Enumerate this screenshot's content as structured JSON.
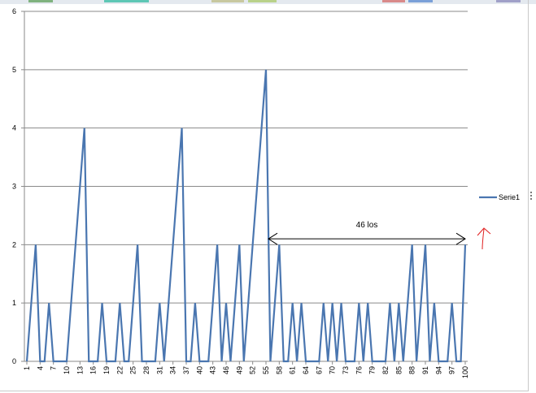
{
  "chart_data": {
    "type": "line",
    "x": [
      1,
      2,
      3,
      4,
      5,
      6,
      7,
      8,
      9,
      10,
      11,
      12,
      13,
      14,
      15,
      16,
      17,
      18,
      19,
      20,
      21,
      22,
      23,
      24,
      25,
      26,
      27,
      28,
      29,
      30,
      31,
      32,
      33,
      34,
      35,
      36,
      37,
      38,
      39,
      40,
      41,
      42,
      43,
      44,
      45,
      46,
      47,
      48,
      49,
      50,
      51,
      52,
      53,
      54,
      55,
      56,
      57,
      58,
      59,
      60,
      61,
      62,
      63,
      64,
      65,
      66,
      67,
      68,
      69,
      70,
      71,
      72,
      73,
      74,
      75,
      76,
      77,
      78,
      79,
      80,
      81,
      82,
      83,
      84,
      85,
      86,
      87,
      88,
      89,
      90,
      91,
      92,
      93,
      94,
      95,
      96,
      97,
      98,
      99,
      100
    ],
    "x_tick_labels": [
      "1",
      "4",
      "7",
      "10",
      "13",
      "16",
      "19",
      "22",
      "25",
      "28",
      "31",
      "34",
      "37",
      "40",
      "43",
      "46",
      "49",
      "52",
      "55",
      "58",
      "61",
      "64",
      "67",
      "70",
      "73",
      "76",
      "79",
      "82",
      "85",
      "88",
      "91",
      "94",
      "97",
      "100"
    ],
    "series": [
      {
        "name": "Serie1",
        "color": "#4a76b0",
        "values": [
          0,
          1,
          2,
          0,
          0,
          1,
          0,
          0,
          0,
          0,
          1,
          2,
          3,
          4,
          0,
          0,
          0,
          1,
          0,
          0,
          0,
          1,
          0,
          0,
          1,
          2,
          0,
          0,
          0,
          0,
          1,
          0,
          1,
          2,
          3,
          4,
          0,
          0,
          1,
          0,
          0,
          0,
          1,
          2,
          0,
          1,
          0,
          1,
          2,
          0,
          1,
          2,
          3,
          4,
          5,
          0,
          1,
          2,
          0,
          0,
          1,
          0,
          1,
          0,
          0,
          0,
          0,
          1,
          0,
          1,
          0,
          1,
          0,
          0,
          0,
          1,
          0,
          1,
          0,
          0,
          0,
          0,
          1,
          0,
          1,
          0,
          1,
          2,
          0,
          1,
          2,
          0,
          1,
          0,
          0,
          0,
          1,
          0,
          0,
          2
        ]
      }
    ],
    "ylim": [
      0,
      6
    ],
    "y_ticks": [
      "0",
      "1",
      "2",
      "3",
      "4",
      "5",
      "6"
    ],
    "grid": true,
    "legend_position": "right",
    "annotations": [
      {
        "text": "46 los",
        "type": "double-arrow",
        "from_x": 55,
        "to_x": 100,
        "y": 2.1
      },
      {
        "type": "hand-drawn-arrow",
        "color": "#e02020",
        "position": "right-of-plot"
      }
    ]
  }
}
